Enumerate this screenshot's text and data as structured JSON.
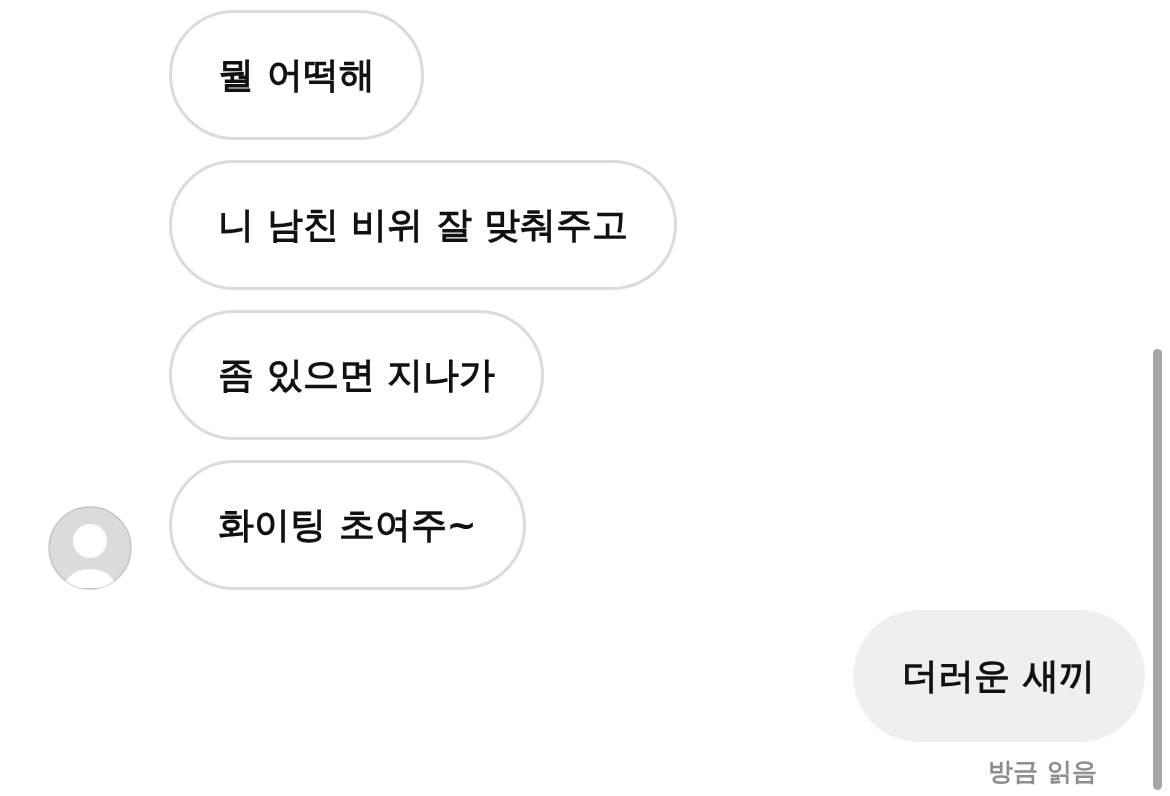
{
  "messages": [
    {
      "kind": "incoming",
      "text": "뭘 어떡해",
      "show_avatar": false
    },
    {
      "kind": "incoming",
      "text": "니 남친 비위 잘 맞춰주고",
      "show_avatar": false
    },
    {
      "kind": "incoming",
      "text": "좀 있으면 지나가",
      "show_avatar": false
    },
    {
      "kind": "incoming",
      "text": "화이팅 초여주~",
      "show_avatar": true
    },
    {
      "kind": "outgoing",
      "text": "더러운 새끼"
    }
  ],
  "read_receipt": "방금 읽음"
}
